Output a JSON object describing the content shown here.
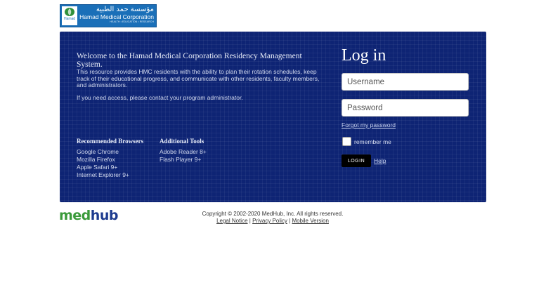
{
  "header": {
    "logo": {
      "arabic_name": "مؤسسة حمد الطبية",
      "english_name": "Hamad Medical Corporation",
      "tagline": "HEALTH • EDUCATION • RESEARCH",
      "mark_text": "Hamad"
    }
  },
  "welcome": {
    "title": "Welcome to the Hamad Medical Corporation Residency Management System.",
    "body": "This resource provides HMC residents with the ability to plan their rotation schedules, keep track of their educational progress, and communicate with other residents, faculty members, and administrators.",
    "contact": "If you need access, please contact your program administrator."
  },
  "browsers": {
    "heading": "Recommended Browsers",
    "items": [
      "Google Chrome",
      "Mozilla Firefox",
      "Apple Safari 9+",
      "Internet Explorer 9+"
    ]
  },
  "tools": {
    "heading": "Additional Tools",
    "items": [
      "Adobe Reader 8+",
      "Flash Player 9+"
    ]
  },
  "login": {
    "title": "Log in",
    "username_placeholder": "Username",
    "password_placeholder": "Password",
    "forgot_label": "Forgot my password",
    "remember_label": "remember me",
    "button_label": "LOGIN",
    "help_label": "Help"
  },
  "footer": {
    "brand_part1": "med",
    "brand_part2": "hub",
    "copyright": "Copyright © 2002-2020 MedHub, Inc. All rights reserved.",
    "links": [
      "Legal Notice",
      "Privacy Policy",
      "Mobile Version"
    ],
    "separator": "|"
  },
  "colors": {
    "panel_bg": "#0e2474",
    "logo_bg": "#1a6fb8",
    "brand_green": "#3a9a3a",
    "brand_blue": "#1d3b8f"
  }
}
